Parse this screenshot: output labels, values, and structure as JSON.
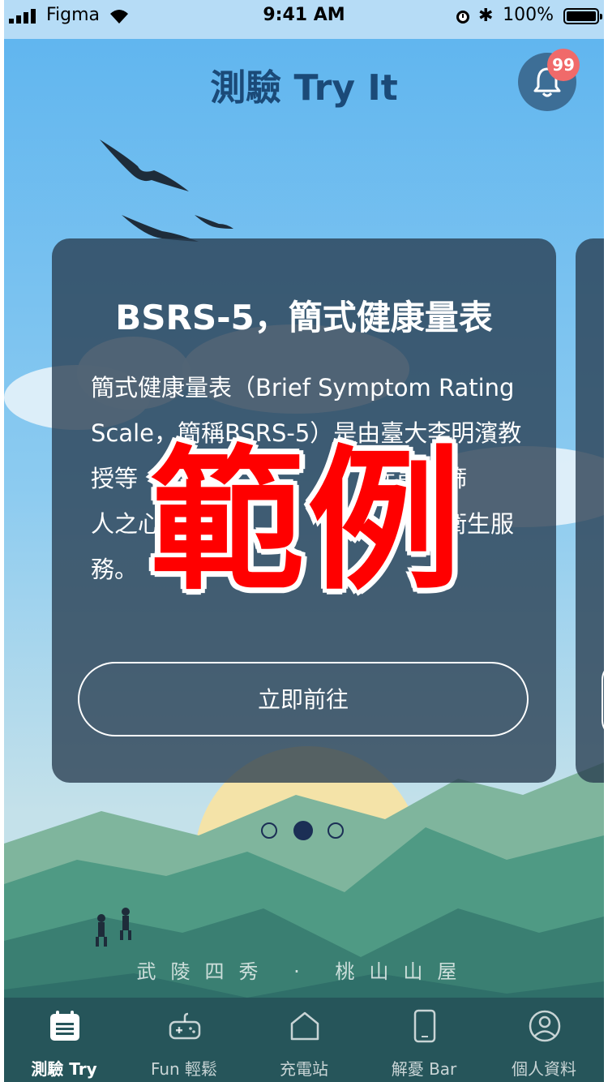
{
  "status_bar": {
    "carrier": "Figma",
    "time": "9:41 AM",
    "battery": "100%"
  },
  "header": {
    "title": "測驗 Try It",
    "notification_count": "99"
  },
  "card": {
    "title": "BSRS-5，簡式健康量表",
    "body": "簡式健康量表（Brief Symptom Rating Scale，簡稱BSRS-5）是由臺大李明濱教授等　　　　　要　　　　疾患之篩　　　　　　　　　　　人之心理　　　　　　　　　　　衛生服務。",
    "button_label": "立即前往"
  },
  "pager": {
    "count": 3,
    "active_index": 1
  },
  "location": "武陵四秀 · 桃山山屋",
  "watermark": "範例",
  "tabs": [
    {
      "label": "測驗 Try",
      "icon": "calendar-list-icon",
      "active": true
    },
    {
      "label": "Fun 輕鬆",
      "icon": "gamepad-icon",
      "active": false
    },
    {
      "label": "充電站",
      "icon": "house-icon",
      "active": false
    },
    {
      "label": "解憂 Bar",
      "icon": "phone-icon",
      "active": false
    },
    {
      "label": "個人資料",
      "icon": "user-circle-icon",
      "active": false
    }
  ],
  "colors": {
    "title": "#1b4a78",
    "badge": "#f06a6a",
    "card": "#283c50",
    "watermark": "#ff0000"
  }
}
